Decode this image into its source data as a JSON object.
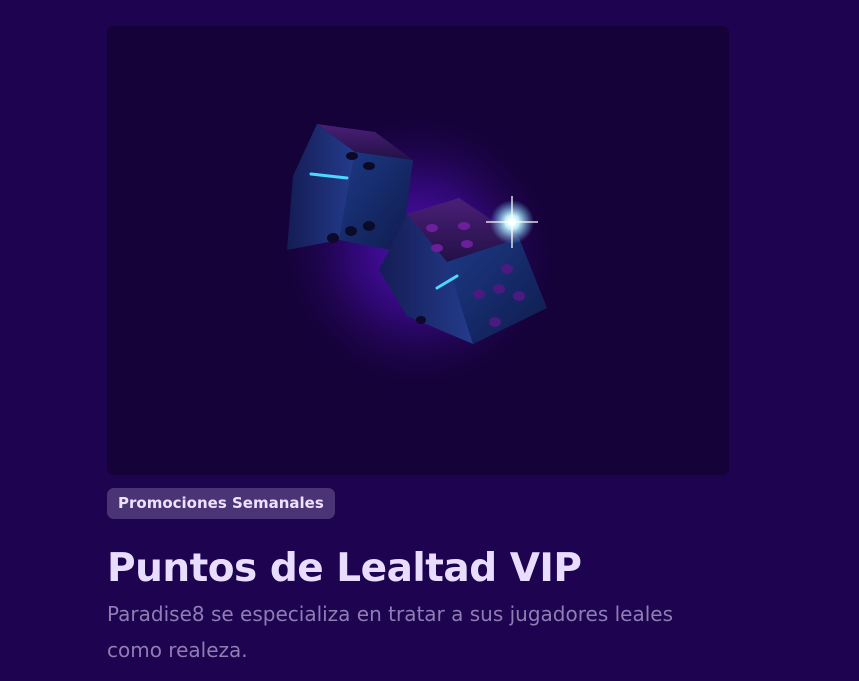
{
  "promo": {
    "image_icon": "dice-icon",
    "badge": "Promociones Semanales",
    "title": "Puntos de Lealtad VIP",
    "description": "Paradise8 se especializa en tratar a sus jugadores leales como realeza."
  },
  "colors": {
    "page_background": "#1e0450",
    "image_background": "#150238",
    "badge_background": "#4a3476",
    "title_text": "#e9ddff",
    "description_text": "#8f7db3"
  }
}
